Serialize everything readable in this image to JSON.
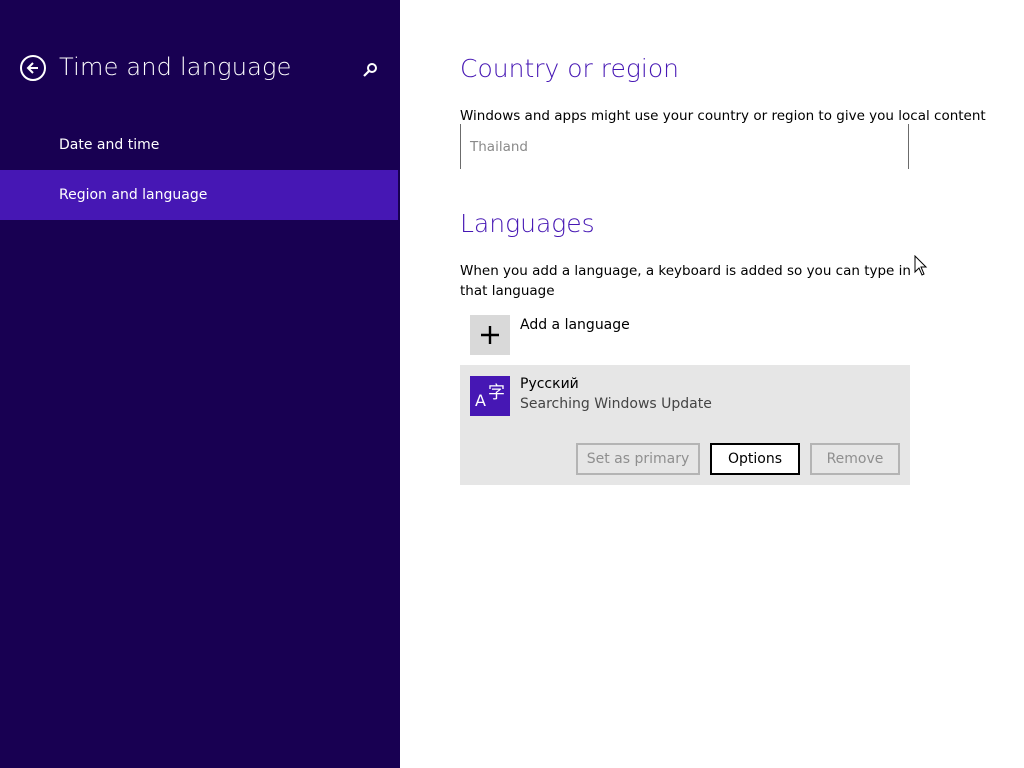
{
  "sidebar": {
    "title": "Time and language",
    "items": [
      {
        "label": "Date and time"
      },
      {
        "label": "Region and language",
        "selected": true
      }
    ]
  },
  "main": {
    "country_section": {
      "title": "Country or region",
      "description": "Windows and apps might use your country or region to give you local content",
      "selected_value": "Thailand"
    },
    "languages_section": {
      "title": "Languages",
      "description": "When you add a language, a keyboard is added so you can type in that language",
      "add_label": "Add a language",
      "languages": [
        {
          "name": "Русский",
          "status": "Searching Windows Update",
          "buttons": {
            "set_primary": "Set as primary",
            "options": "Options",
            "remove": "Remove"
          }
        }
      ]
    }
  },
  "colors": {
    "sidebar_bg": "#180052",
    "selected_item": "#4617b4",
    "accent": "#4617b4"
  },
  "icons": {
    "back": "back-arrow-icon",
    "search": "search-icon",
    "add": "plus-icon",
    "language": "language-icon"
  }
}
